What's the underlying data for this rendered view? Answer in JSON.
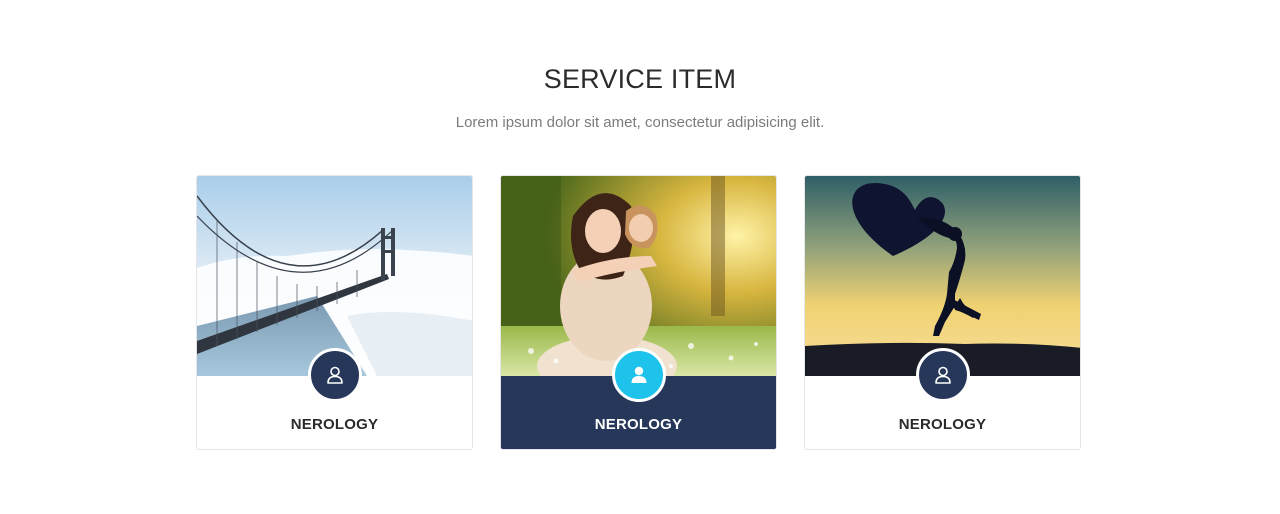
{
  "section": {
    "title": "SERVICE ITEM",
    "subtitle": "Lorem ipsum dolor sit amet, consectetur adipisicing elit."
  },
  "cards": [
    {
      "label": "NEROLOGY",
      "image": "bridge-in-fog-photo",
      "icon": "user-icon",
      "active": false
    },
    {
      "label": "NEROLOGY",
      "image": "mother-and-daughter-photo",
      "icon": "user-icon",
      "active": true
    },
    {
      "label": "NEROLOGY",
      "image": "heart-silhouette-sunset-photo",
      "icon": "user-icon",
      "active": false
    }
  ],
  "colors": {
    "navy": "#26375a",
    "cyan": "#1ec3ec",
    "title": "#2b2b2b",
    "subtitle": "#7b7b7b"
  }
}
